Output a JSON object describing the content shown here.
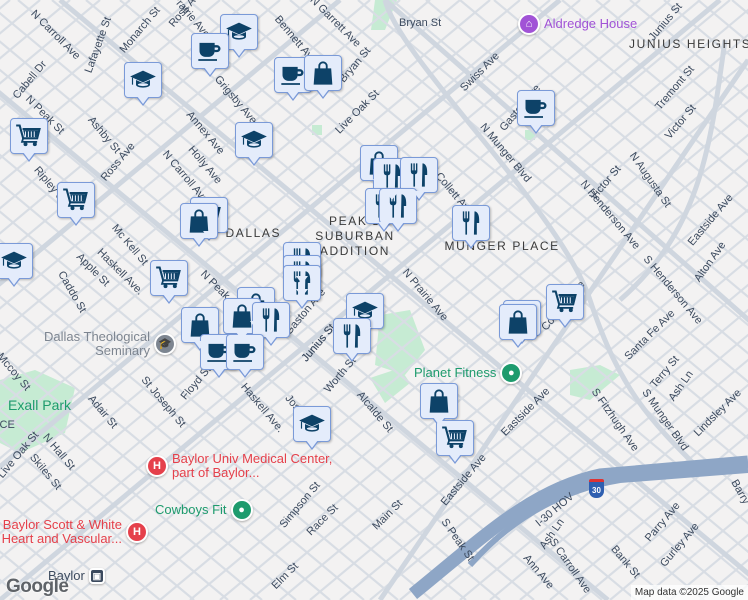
{
  "map": {
    "attribution": "Map data ©2025 Google",
    "logo": "Google",
    "highway_shield": "30",
    "colors": {
      "background": "#f3f2f2",
      "road": "#d5dbe3",
      "highway": "#8ea6c6",
      "park": "#c6ebd3",
      "marker_fill": "#e4ecfb",
      "marker_border": "#7a9ad8",
      "marker_icon": "#0d4268",
      "hospital": "#e5404b",
      "fitness": "#1e9b6d",
      "landmark": "#a153d6",
      "school": "#7d8590"
    }
  },
  "streets": [
    "N Carroll Ave",
    "Lafayette St",
    "Monarch St",
    "N Prairie Ave",
    "Cabell Dr",
    "N Peak St",
    "Ashby St",
    "Ross Ave",
    "N Carroll Ave",
    "Holly Ave",
    "Annex Ave",
    "Grigsby Ave",
    "Bennett Ave",
    "N Garrett Ave",
    "Bryan St",
    "Live Oak St",
    "Ripley St",
    "Mc Kell St",
    "Haskell Ave.",
    "Apple St",
    "Caddo St",
    "N Peak St",
    "Bryan St",
    "Junius St",
    "Swiss Ave",
    "Gaston Ave",
    "N Munger Blvd",
    "Tremont St",
    "Victor St",
    "Victor St",
    "N Augusta St",
    "N Henderson Ave",
    "Eastside Ave",
    "Alton Ave",
    "S Henderson Ave",
    "N Collett Ave",
    "N Prairie Ave",
    "Santa Fe Ave",
    "Terry St",
    "Ash Ln",
    "S Munger Blvd",
    "Lindsley Ave",
    "S Fitzhugh Ave",
    "Eastside Ave",
    "Eastside Ave",
    "I-30 HOV",
    "Ash Ln",
    "S Carroll Ave",
    "Ann Ave",
    "Bank St",
    "Parry Ave",
    "Gurley Ave",
    "Barry",
    "S Peak St",
    "Main St",
    "Alcalde St",
    "Worth St",
    "Junius St",
    "Gaston Ave",
    "Haskell Ave.",
    "Jos",
    "St Joseph St",
    "Floyd St",
    "Adair St",
    "Mccoy St",
    "N Hall St",
    "Skiles St",
    "Live Oak St",
    "Simpson St",
    "Race St",
    "Elm St",
    "Colonial Ave",
    "Ross Ave",
    "Junius St",
    "CE"
  ],
  "areas": [
    "EAST DALLAS",
    "PEAK'S SUBURBAN ADDITION",
    "MUNGER PLACE",
    "JUNIUS HEIGHTS"
  ],
  "pois": [
    {
      "name": "Aldredge House",
      "category": "landmark",
      "icon": "museum-icon"
    },
    {
      "name": "Dallas Theological Seminary",
      "category": "school",
      "icon": "graduation-cap-icon"
    },
    {
      "name": "Exall Park",
      "category": "park",
      "icon": ""
    },
    {
      "name": "Baylor Univ Medical Center, part of Baylor...",
      "category": "hospital",
      "icon": "hospital-icon"
    },
    {
      "name": "Cowboys Fit",
      "category": "fitness",
      "icon": "fitness-icon"
    },
    {
      "name": "Baylor Scott & White Heart and Vascular...",
      "category": "hospital",
      "icon": "hospital-icon"
    },
    {
      "name": "Planet Fitness",
      "category": "fitness",
      "icon": "fitness-icon"
    },
    {
      "name": "Baylor",
      "category": "transit",
      "icon": "train-icon"
    }
  ],
  "markers": [
    {
      "type": "school"
    },
    {
      "type": "coffee"
    },
    {
      "type": "school"
    },
    {
      "type": "coffee"
    },
    {
      "type": "shopping"
    },
    {
      "type": "grocery"
    },
    {
      "type": "school"
    },
    {
      "type": "shopping"
    },
    {
      "type": "restaurant"
    },
    {
      "type": "restaurant"
    },
    {
      "type": "restaurant"
    },
    {
      "type": "restaurant"
    },
    {
      "type": "restaurant"
    },
    {
      "type": "coffee"
    },
    {
      "type": "grocery"
    },
    {
      "type": "shopping"
    },
    {
      "type": "grocery"
    },
    {
      "type": "school"
    },
    {
      "type": "grocery"
    },
    {
      "type": "restaurant"
    },
    {
      "type": "restaurant"
    },
    {
      "type": "restaurant"
    },
    {
      "type": "shopping"
    },
    {
      "type": "shopping"
    },
    {
      "type": "restaurant"
    },
    {
      "type": "shopping"
    },
    {
      "type": "coffee"
    },
    {
      "type": "coffee"
    },
    {
      "type": "school"
    },
    {
      "type": "restaurant"
    },
    {
      "type": "shopping"
    },
    {
      "type": "shopping"
    },
    {
      "type": "grocery"
    },
    {
      "type": "shopping"
    },
    {
      "type": "grocery"
    },
    {
      "type": "school"
    }
  ]
}
